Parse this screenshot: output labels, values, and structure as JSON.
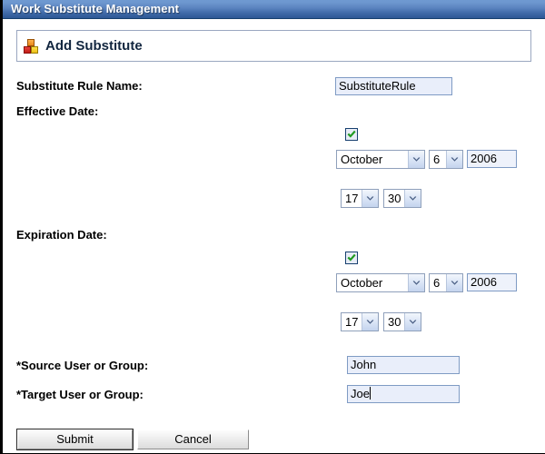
{
  "window": {
    "title": "Work Substitute Management"
  },
  "header": {
    "icon": "blocks-icon",
    "title": "Add Substitute"
  },
  "form": {
    "rule_name": {
      "label": "Substitute Rule Name:",
      "value": "SubstituteRule"
    },
    "effective_date": {
      "label": "Effective Date:",
      "enabled_checkbox": "checked",
      "month": "October",
      "day": "6",
      "year": "2006",
      "hour": "17",
      "minute": "30"
    },
    "expiration_date": {
      "label": "Expiration Date:",
      "enabled_checkbox": "checked",
      "month": "October",
      "day": "6",
      "year": "2006",
      "hour": "17",
      "minute": "30"
    },
    "source_user": {
      "label": "*Source User or Group:",
      "value": "John"
    },
    "target_user": {
      "label": "*Target User or Group:",
      "value": "Joe"
    }
  },
  "actions": {
    "submit_label": "Submit",
    "cancel_label": "Cancel"
  },
  "colors": {
    "titlebar_top": "#6f9ad1",
    "titlebar_bottom": "#2d5795",
    "field_bg": "#e9eefa",
    "field_border": "#7f9bc4",
    "checkmark": "#1f9a1f",
    "panel_border": "#9aa7c0"
  }
}
